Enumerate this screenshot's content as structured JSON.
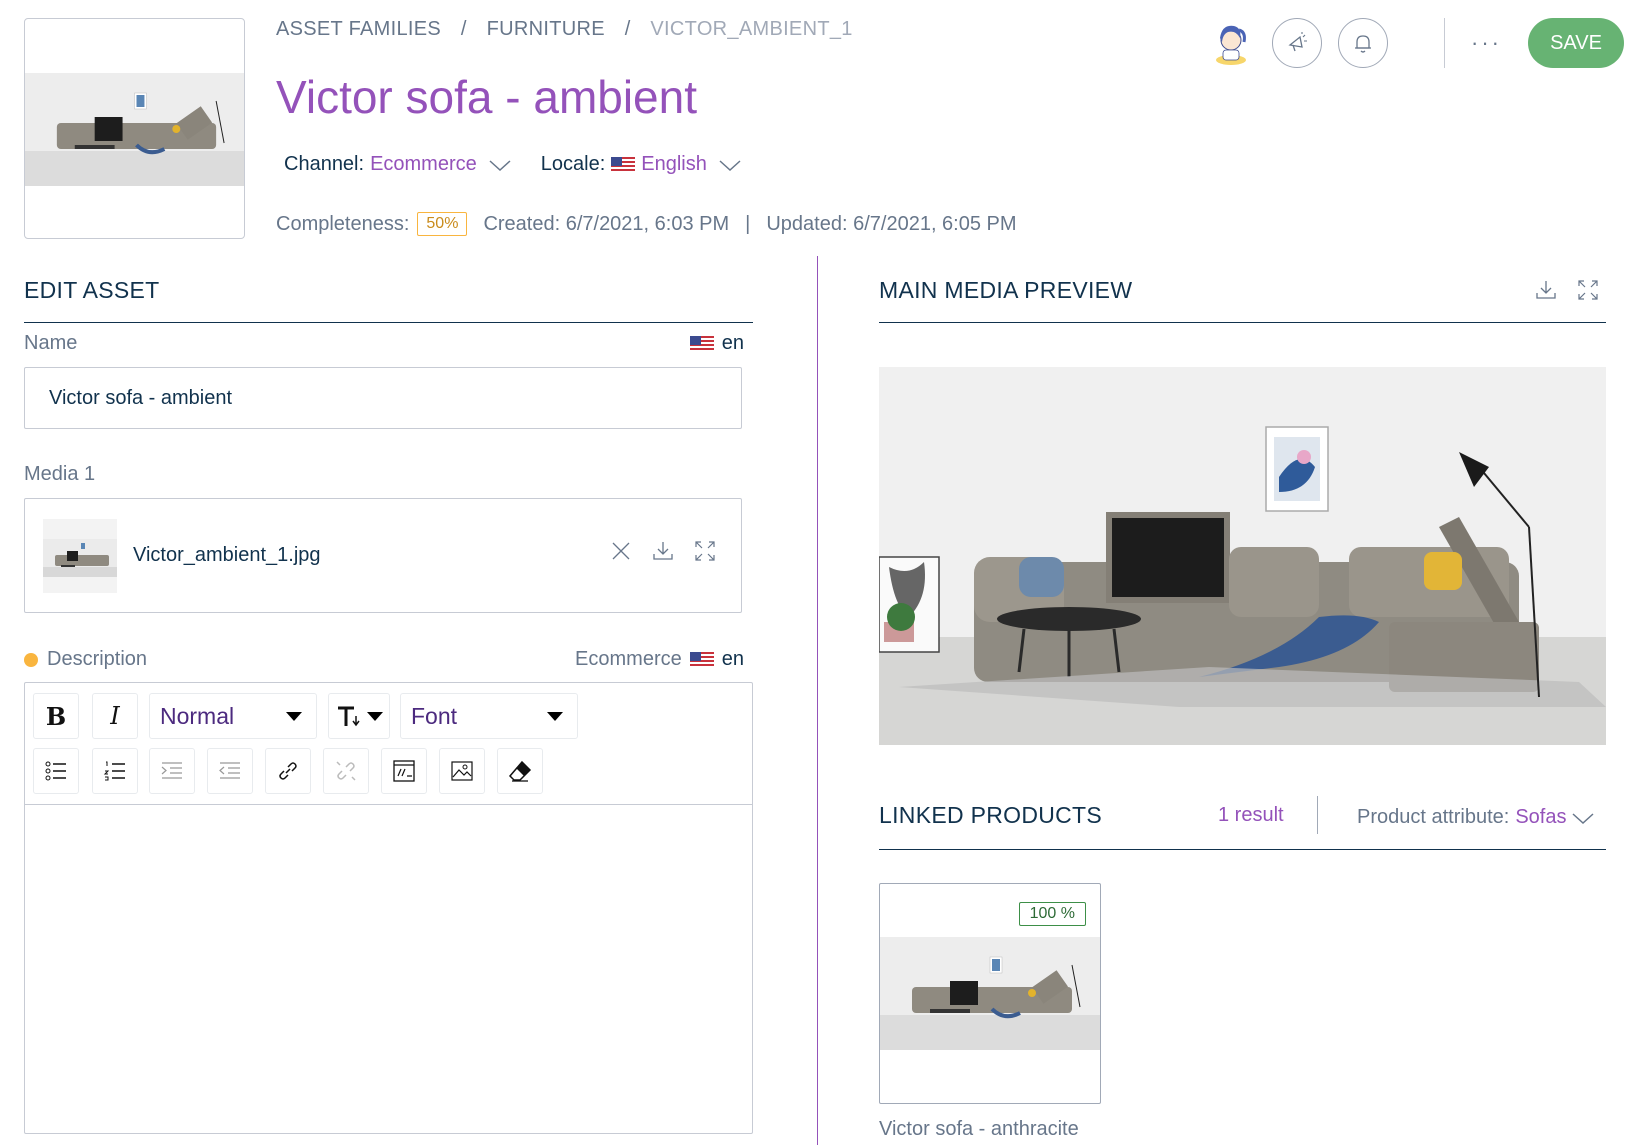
{
  "breadcrumb": {
    "items": [
      {
        "label": "ASSET FAMILIES"
      },
      {
        "label": "FURNITURE"
      },
      {
        "label": "VICTOR_AMBIENT_1"
      }
    ],
    "separator": "/"
  },
  "header": {
    "title": "Victor sofa - ambient",
    "channel_label": "Channel:",
    "channel_value": "Ecommerce",
    "locale_label": "Locale:",
    "locale_value": "English",
    "completeness_label": "Completeness:",
    "completeness_value": "50%",
    "created": "Created: 6/7/2021, 6:03 PM",
    "meta_separator": "|",
    "updated": "Updated: 6/7/2021, 6:05 PM",
    "more_label": "···",
    "save_label": "SAVE"
  },
  "edit_asset": {
    "title": "EDIT ASSET",
    "name_label": "Name",
    "name_locale": "en",
    "name_value": "Victor sofa - ambient",
    "media_label": "Media 1",
    "media_filename": "Victor_ambient_1.jpg",
    "description_label": "Description",
    "description_channel": "Ecommerce",
    "description_locale": "en",
    "toolbar": {
      "bold": "B",
      "italic": "I",
      "heading_value": "Normal",
      "font_value": "Font"
    }
  },
  "preview": {
    "title": "MAIN MEDIA PREVIEW"
  },
  "linked_products": {
    "title": "LINKED PRODUCTS",
    "result_count": "1 result",
    "attribute_label": "Product attribute:",
    "attribute_value": "Sofas",
    "products": [
      {
        "name": "Victor sofa - anthracite",
        "completeness": "100 %"
      }
    ]
  },
  "icons": {
    "avatar": "avatar-icon",
    "announcements": "megaphone-icon",
    "notifications": "bell-icon",
    "remove": "close-icon",
    "download": "download-icon",
    "fullscreen": "fullscreen-icon",
    "dropdown": "chevron-down-icon"
  },
  "colors": {
    "brand_purple": "#9452ba",
    "save_green": "#67b373",
    "warning_orange": "#f9b53f",
    "success_green": "#3d8f47",
    "text_dark": "#11324d",
    "text_grey": "#67768a"
  }
}
